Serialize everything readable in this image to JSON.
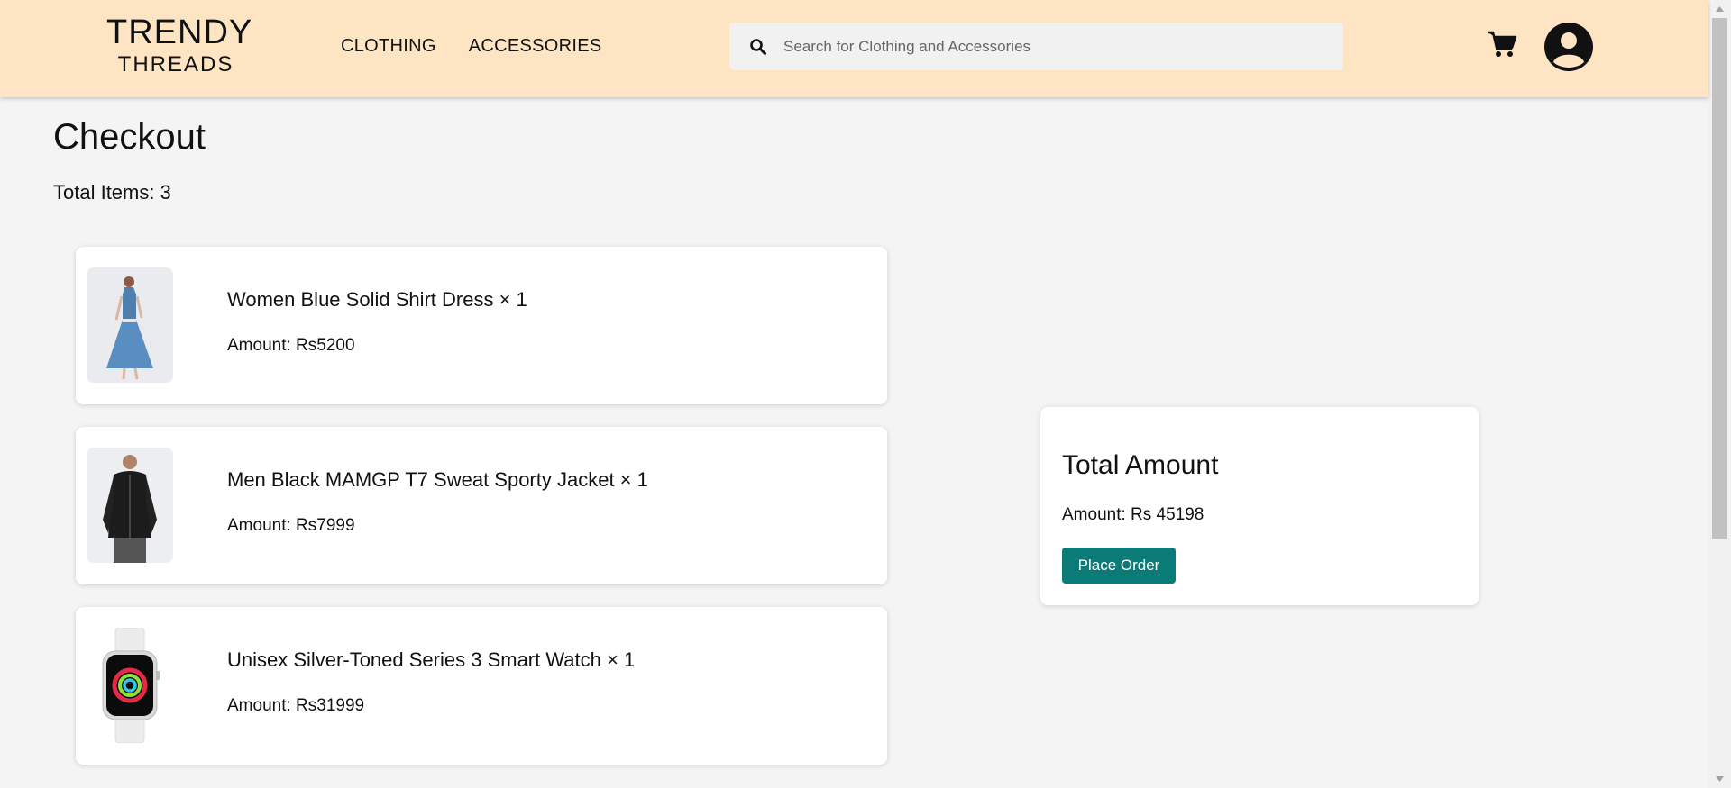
{
  "header": {
    "logo_top": "TRENDY",
    "logo_bottom": "THREADS",
    "nav": [
      "CLOTHING",
      "ACCESSORIES"
    ],
    "search_placeholder": "Search for Clothing and Accessories",
    "icons": [
      "search-icon",
      "cart-icon",
      "user-profile-icon"
    ],
    "background_color": "#fde5c3"
  },
  "checkout": {
    "title": "Checkout",
    "total_items": "Total Items: 3",
    "items": [
      {
        "name": "Women Blue Solid Shirt Dress × 1",
        "amount": "Amount: Rs5200",
        "image": "blue-dress-photo"
      },
      {
        "name": "Men Black MAMGP T7 Sweat Sporty Jacket × 1",
        "amount": "Amount: Rs7999",
        "image": "black-jacket-photo"
      },
      {
        "name": "Unisex Silver-Toned Series 3 Smart Watch × 1",
        "amount": "Amount: Rs31999",
        "image": "smart-watch-photo"
      }
    ]
  },
  "summary": {
    "title": "Total Amount",
    "amount": "Amount: Rs 45198",
    "button_label": "Place Order",
    "button_color": "#0a7b76"
  }
}
